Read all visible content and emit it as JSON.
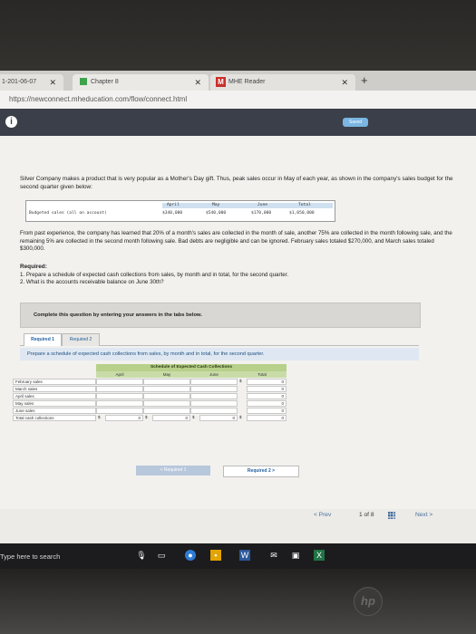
{
  "browser": {
    "tabs": [
      {
        "label": "1-201-06-07"
      },
      {
        "label": "Chapter 8"
      },
      {
        "label": "MHE Reader"
      }
    ],
    "url": "https://newconnect.mheducation.com/flow/connect.html"
  },
  "app": {
    "saved_label": "Saved"
  },
  "problem": {
    "intro": "Silver Company makes a product that is very popular as a Mother's Day gift. Thus, peak sales occur in May of each year, as shown in the company's sales budget for the second quarter given below:",
    "budget": {
      "row_label": "Budgeted sales (all on account)",
      "headers": [
        "April",
        "May",
        "June",
        "Total"
      ],
      "values": [
        "$340,000",
        "$540,000",
        "$170,000",
        "$1,050,000"
      ]
    },
    "experience": "From past experience, the company has learned that 20% of a month's sales are collected in the month of sale, another 75% are collected in the month following sale, and the remaining 5% are collected in the second month following sale. Bad debts are negligible and can be ignored. February sales totaled $270,000, and March sales totaled $300,000.",
    "required_title": "Required:",
    "required_items": [
      "1. Prepare a schedule of expected cash collections from sales, by month and in total, for the second quarter.",
      "2. What is the accounts receivable balance on June 30th?"
    ]
  },
  "instructions": "Complete this question by entering your answers in the tabs below.",
  "req_tabs": [
    "Required 1",
    "Required 2"
  ],
  "sub_instruction": "Prepare a schedule of expected cash collections from sales, by month and in total, for the second quarter.",
  "schedule": {
    "title": "Schedule of Expected Cash Collections",
    "columns": [
      "April",
      "May",
      "June",
      "Total"
    ],
    "rows": [
      {
        "label": "February sales",
        "total": "0"
      },
      {
        "label": "March sales",
        "total": "0"
      },
      {
        "label": "April sales",
        "total": "0"
      },
      {
        "label": "May sales",
        "total": "0"
      },
      {
        "label": "June sales",
        "total": "0"
      },
      {
        "label": "Total cash collections",
        "april": "0",
        "may": "0",
        "june": "0",
        "total": "0"
      }
    ],
    "dollar": "$"
  },
  "nav": {
    "prev_label": "< Required 1",
    "next_label": "Required 2 >"
  },
  "pager": {
    "prev": "< Prev",
    "position": "1 of 8",
    "next": "Next >"
  },
  "taskbar": {
    "search": "Type here to search"
  },
  "logo": "hp"
}
